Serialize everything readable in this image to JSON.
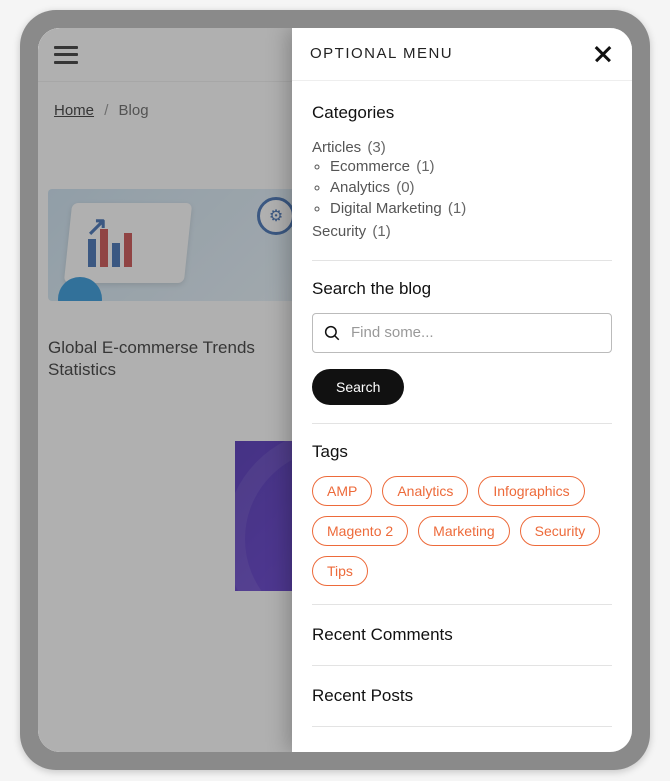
{
  "breadcrumb": {
    "home": "Home",
    "current": "Blog"
  },
  "article": {
    "title": "Global E-commerse Trends\nStatistics"
  },
  "drawer": {
    "title": "OPTIONAL MENU",
    "sections": {
      "categories_heading": "Categories",
      "categories": [
        {
          "label": "Articles",
          "count": "(3)",
          "children": [
            {
              "label": "Ecommerce",
              "count": "(1)"
            },
            {
              "label": "Analytics",
              "count": "(0)"
            },
            {
              "label": "Digital Marketing",
              "count": "(1)"
            }
          ]
        },
        {
          "label": "Security",
          "count": "(1)"
        }
      ],
      "search_heading": "Search the blog",
      "search_placeholder": "Find some...",
      "search_button": "Search",
      "tags_heading": "Tags",
      "tags": [
        "AMP",
        "Analytics",
        "Infographics",
        "Magento 2",
        "Marketing",
        "Security",
        "Tips"
      ],
      "recent_comments_heading": "Recent Comments",
      "recent_posts_heading": "Recent Posts"
    }
  },
  "colors": {
    "accent": "#ed6a3a"
  }
}
